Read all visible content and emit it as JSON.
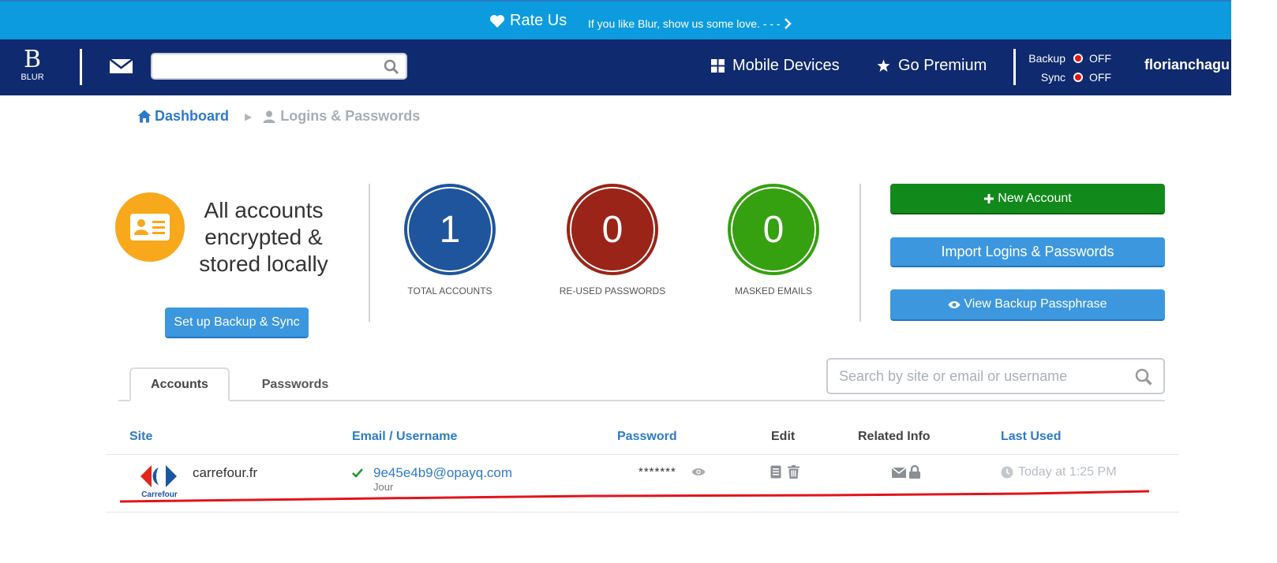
{
  "banner": {
    "rate_label": "Rate Us",
    "rate_sub": "If you like Blur, show us some love. - - -"
  },
  "nav": {
    "logo_mark": "B",
    "logo_text": "BLUR",
    "search_value": "",
    "mobile_devices": "Mobile Devices",
    "go_premium": "Go Premium",
    "backup_label": "Backup",
    "backup_status": "OFF",
    "sync_label": "Sync",
    "sync_status": "OFF",
    "username": "florianchagu",
    "status_color": "#ee1111"
  },
  "breadcrumb": {
    "home": "Dashboard",
    "current": "Logins & Passwords"
  },
  "summary": {
    "encrypted_text": "All accounts encrypted & stored locally",
    "setup_button": "Set up Backup & Sync"
  },
  "stats": [
    {
      "value": "1",
      "label": "TOTAL ACCOUNTS",
      "color": "#1f559c"
    },
    {
      "value": "0",
      "label": "RE-USED PASSWORDS",
      "color": "#9a2418"
    },
    {
      "value": "0",
      "label": "MASKED EMAILS",
      "color": "#35a010"
    }
  ],
  "actions": {
    "new_account": "New Account",
    "import": "Import Logins & Passwords",
    "view_backup": "View Backup Passphrase"
  },
  "tabs": {
    "accounts": "Accounts",
    "passwords": "Passwords"
  },
  "table_search": {
    "placeholder": "Search by site or email or username"
  },
  "table": {
    "headers": {
      "site": "Site",
      "email": "Email / Username",
      "password": "Password",
      "edit": "Edit",
      "related": "Related Info",
      "last_used": "Last Used"
    },
    "rows": [
      {
        "site": "carrefour.fr",
        "logo_text": "Carrefour",
        "email": "9e45e4b9@opayq.com",
        "email_note": "Jour",
        "password": "*******",
        "last_used": "Today at 1:25 PM"
      }
    ]
  }
}
